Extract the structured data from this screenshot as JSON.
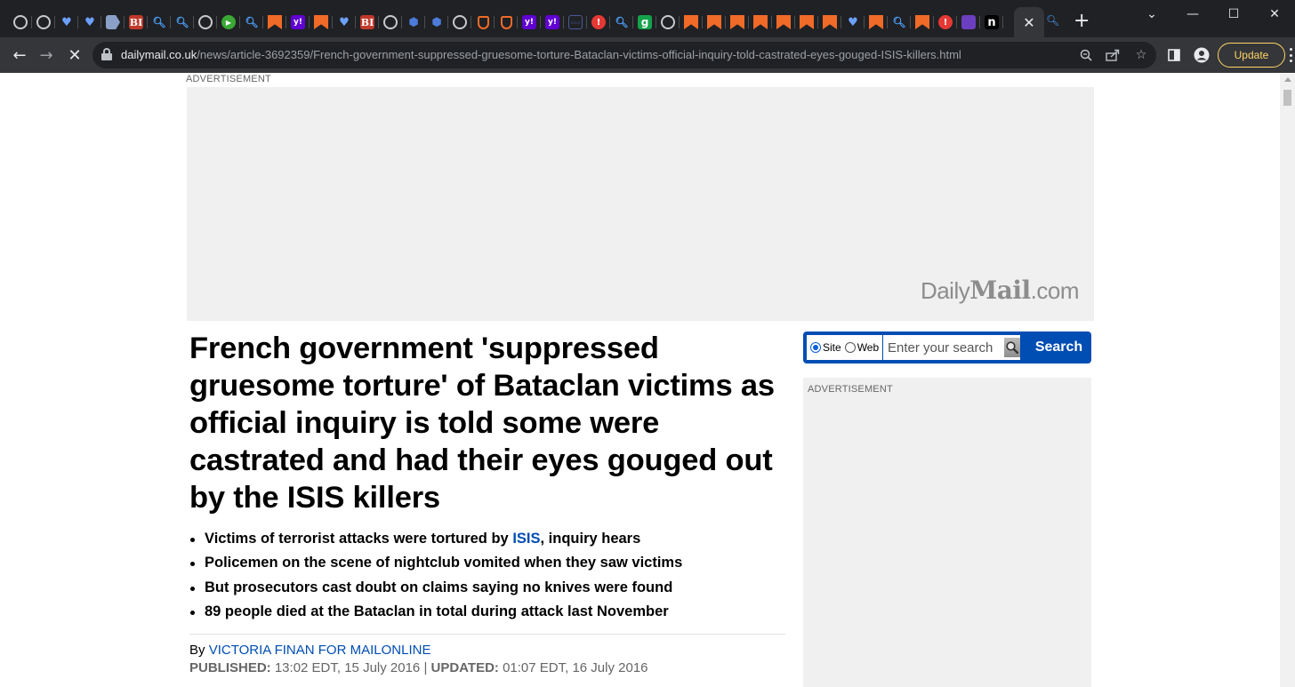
{
  "browser": {
    "tab_favicons": [
      "globe",
      "globe",
      "shield",
      "shield",
      "tag",
      "bi",
      "search",
      "search",
      "globe",
      "play",
      "search",
      "bookmark",
      "yahoo",
      "bookmark",
      "shield",
      "bi",
      "globe",
      "cube",
      "cube",
      "globe",
      "orangeshield",
      "orangeshield",
      "yahoo",
      "yahoo",
      "boxline",
      "redpin",
      "search",
      "g",
      "globe",
      "bookmark",
      "bookmark",
      "bookmark",
      "bookmark",
      "bookmark",
      "bookmark",
      "bookmark",
      "shield",
      "bookmark",
      "search",
      "bookmark",
      "redpin",
      "mail",
      "n"
    ],
    "active_tab_close": "✕",
    "new_tab": "+",
    "window_controls": {
      "minimize": "—",
      "maximize": "☐",
      "close": "✕"
    },
    "url_domain": "dailymail.co.uk",
    "url_path": "/news/article-3692359/French-government-suppressed-gruesome-torture-Bataclan-victims-official-inquiry-told-castrated-eyes-gouged-ISIS-killers.html",
    "update_label": "Update"
  },
  "page": {
    "top_ad_label": "ADVERTISEMENT",
    "logo": {
      "daily": "Daily",
      "mail": "Mail",
      "com": ".com"
    },
    "headline": "French government 'suppressed gruesome torture' of Bataclan victims as official inquiry is told some were castrated and had their eyes gouged out by the ISIS killers",
    "bullets": [
      {
        "before": "Victims of terrorist attacks were tortured by ",
        "link": "ISIS",
        "after": ", inquiry hears"
      },
      {
        "text": "Policemen on the scene of nightclub vomited when they saw victims"
      },
      {
        "text": "But prosecutors cast doubt on claims saying no knives were found"
      },
      {
        "text": "89 people died at the Bataclan in total during attack last November"
      }
    ],
    "byline_prefix": "By ",
    "author": "VICTORIA FINAN FOR MAILONLINE",
    "published_label": "PUBLISHED:",
    "published": " 13:02 EDT, 15 July 2016 | ",
    "updated_label": "UPDATED:",
    "updated": " 01:07 EDT, 16 July 2016"
  },
  "search": {
    "option_site": "Site",
    "option_web": "Web",
    "placeholder": "Enter your search",
    "button": "Search"
  },
  "side_ad_label": "ADVERTISEMENT",
  "colors": {
    "link_blue": "#004db3",
    "ad_gray": "#f0f0f0",
    "chrome_dark": "#202124",
    "update_yellow": "#fdd663"
  }
}
